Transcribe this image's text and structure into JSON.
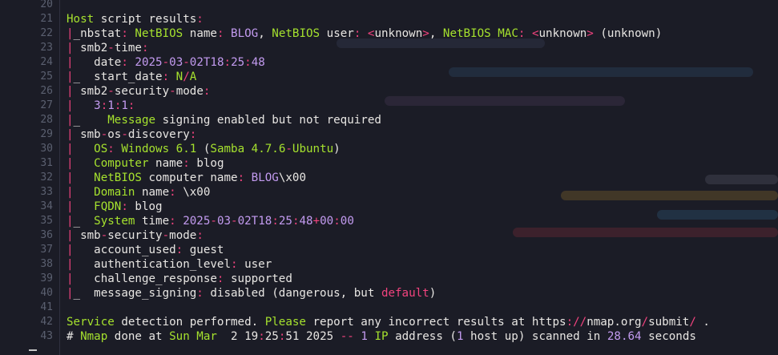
{
  "colors": {
    "background": "#1b1c26",
    "line_number": "#5b6070",
    "text": "#e8e6e3",
    "green": "#a6e22e",
    "purple": "#c39bf0",
    "pink": "#f2437e"
  },
  "lines": [
    {
      "n": "20",
      "segs": []
    },
    {
      "n": "21",
      "segs": [
        {
          "t": "Host",
          "c": "g"
        },
        {
          "t": " script results",
          "c": "w"
        },
        {
          "t": ":",
          "c": "r"
        }
      ]
    },
    {
      "n": "22",
      "segs": [
        {
          "t": "|",
          "c": "r"
        },
        {
          "t": "_nbstat",
          "c": "w"
        },
        {
          "t": ":",
          "c": "r"
        },
        {
          "t": " NetBIOS",
          "c": "g"
        },
        {
          "t": " name",
          "c": "w"
        },
        {
          "t": ":",
          "c": "r"
        },
        {
          "t": " BLOG",
          "c": "p"
        },
        {
          "t": ",",
          "c": "w"
        },
        {
          "t": " NetBIOS",
          "c": "g"
        },
        {
          "t": " user",
          "c": "w"
        },
        {
          "t": ":",
          "c": "r"
        },
        {
          "t": " <",
          "c": "r"
        },
        {
          "t": "unknown",
          "c": "w"
        },
        {
          "t": ">",
          "c": "r"
        },
        {
          "t": ",",
          "c": "w"
        },
        {
          "t": " NetBIOS MAC",
          "c": "g"
        },
        {
          "t": ":",
          "c": "r"
        },
        {
          "t": " <",
          "c": "r"
        },
        {
          "t": "unknown",
          "c": "w"
        },
        {
          "t": ">",
          "c": "r"
        },
        {
          "t": " (unknown)",
          "c": "w"
        }
      ]
    },
    {
      "n": "23",
      "segs": [
        {
          "t": "|",
          "c": "r"
        },
        {
          "t": " smb2",
          "c": "w"
        },
        {
          "t": "-",
          "c": "r"
        },
        {
          "t": "time",
          "c": "w"
        },
        {
          "t": ":",
          "c": "r"
        }
      ]
    },
    {
      "n": "24",
      "segs": [
        {
          "t": "|",
          "c": "r"
        },
        {
          "t": "   date",
          "c": "w"
        },
        {
          "t": ":",
          "c": "r"
        },
        {
          "t": " 2025",
          "c": "p"
        },
        {
          "t": "-",
          "c": "r"
        },
        {
          "t": "03",
          "c": "p"
        },
        {
          "t": "-",
          "c": "r"
        },
        {
          "t": "02T18",
          "c": "p"
        },
        {
          "t": ":",
          "c": "r"
        },
        {
          "t": "25",
          "c": "p"
        },
        {
          "t": ":",
          "c": "r"
        },
        {
          "t": "48",
          "c": "p"
        }
      ]
    },
    {
      "n": "25",
      "segs": [
        {
          "t": "|",
          "c": "r"
        },
        {
          "t": "_  start_date",
          "c": "w"
        },
        {
          "t": ":",
          "c": "r"
        },
        {
          "t": " N",
          "c": "g"
        },
        {
          "t": "/",
          "c": "r"
        },
        {
          "t": "A",
          "c": "g"
        }
      ]
    },
    {
      "n": "26",
      "segs": [
        {
          "t": "|",
          "c": "r"
        },
        {
          "t": " smb2",
          "c": "w"
        },
        {
          "t": "-",
          "c": "r"
        },
        {
          "t": "security",
          "c": "w"
        },
        {
          "t": "-",
          "c": "r"
        },
        {
          "t": "mode",
          "c": "w"
        },
        {
          "t": ":",
          "c": "r"
        }
      ]
    },
    {
      "n": "27",
      "segs": [
        {
          "t": "|",
          "c": "r"
        },
        {
          "t": "   ",
          "c": "w"
        },
        {
          "t": "3",
          "c": "p"
        },
        {
          "t": ":",
          "c": "r"
        },
        {
          "t": "1",
          "c": "p"
        },
        {
          "t": ":",
          "c": "r"
        },
        {
          "t": "1",
          "c": "p"
        },
        {
          "t": ":",
          "c": "r"
        }
      ]
    },
    {
      "n": "28",
      "segs": [
        {
          "t": "|",
          "c": "r"
        },
        {
          "t": "_    ",
          "c": "w"
        },
        {
          "t": "Message",
          "c": "g"
        },
        {
          "t": " signing enabled but not required",
          "c": "w"
        }
      ]
    },
    {
      "n": "29",
      "segs": [
        {
          "t": "|",
          "c": "r"
        },
        {
          "t": " smb",
          "c": "w"
        },
        {
          "t": "-",
          "c": "r"
        },
        {
          "t": "os",
          "c": "w"
        },
        {
          "t": "-",
          "c": "r"
        },
        {
          "t": "discovery",
          "c": "w"
        },
        {
          "t": ":",
          "c": "r"
        }
      ]
    },
    {
      "n": "30",
      "segs": [
        {
          "t": "|",
          "c": "r"
        },
        {
          "t": "   ",
          "c": "w"
        },
        {
          "t": "OS",
          "c": "g"
        },
        {
          "t": ":",
          "c": "r"
        },
        {
          "t": " Windows 6.1",
          "c": "g"
        },
        {
          "t": " (",
          "c": "w"
        },
        {
          "t": "Samba 4.7.6",
          "c": "g"
        },
        {
          "t": "-",
          "c": "r"
        },
        {
          "t": "Ubuntu",
          "c": "g"
        },
        {
          "t": ")",
          "c": "w"
        }
      ]
    },
    {
      "n": "31",
      "segs": [
        {
          "t": "|",
          "c": "r"
        },
        {
          "t": "   ",
          "c": "w"
        },
        {
          "t": "Computer",
          "c": "g"
        },
        {
          "t": " name",
          "c": "w"
        },
        {
          "t": ":",
          "c": "r"
        },
        {
          "t": " blog",
          "c": "w"
        }
      ]
    },
    {
      "n": "32",
      "segs": [
        {
          "t": "|",
          "c": "r"
        },
        {
          "t": "   ",
          "c": "w"
        },
        {
          "t": "NetBIOS",
          "c": "g"
        },
        {
          "t": " computer name",
          "c": "w"
        },
        {
          "t": ":",
          "c": "r"
        },
        {
          "t": " BLOG",
          "c": "p"
        },
        {
          "t": "\\x00",
          "c": "w"
        }
      ]
    },
    {
      "n": "33",
      "segs": [
        {
          "t": "|",
          "c": "r"
        },
        {
          "t": "   ",
          "c": "w"
        },
        {
          "t": "Domain",
          "c": "g"
        },
        {
          "t": " name",
          "c": "w"
        },
        {
          "t": ":",
          "c": "r"
        },
        {
          "t": " \\x00",
          "c": "w"
        }
      ]
    },
    {
      "n": "34",
      "segs": [
        {
          "t": "|",
          "c": "r"
        },
        {
          "t": "   ",
          "c": "w"
        },
        {
          "t": "FQDN",
          "c": "g"
        },
        {
          "t": ":",
          "c": "r"
        },
        {
          "t": " blog",
          "c": "w"
        }
      ]
    },
    {
      "n": "35",
      "segs": [
        {
          "t": "|",
          "c": "r"
        },
        {
          "t": "_  ",
          "c": "w"
        },
        {
          "t": "System",
          "c": "g"
        },
        {
          "t": " time",
          "c": "w"
        },
        {
          "t": ":",
          "c": "r"
        },
        {
          "t": " 2025",
          "c": "p"
        },
        {
          "t": "-",
          "c": "r"
        },
        {
          "t": "03",
          "c": "p"
        },
        {
          "t": "-",
          "c": "r"
        },
        {
          "t": "02T18",
          "c": "p"
        },
        {
          "t": ":",
          "c": "r"
        },
        {
          "t": "25",
          "c": "p"
        },
        {
          "t": ":",
          "c": "r"
        },
        {
          "t": "48",
          "c": "p"
        },
        {
          "t": "+",
          "c": "r"
        },
        {
          "t": "00",
          "c": "p"
        },
        {
          "t": ":",
          "c": "r"
        },
        {
          "t": "00",
          "c": "p"
        }
      ]
    },
    {
      "n": "36",
      "segs": [
        {
          "t": "|",
          "c": "r"
        },
        {
          "t": " smb",
          "c": "w"
        },
        {
          "t": "-",
          "c": "r"
        },
        {
          "t": "security",
          "c": "w"
        },
        {
          "t": "-",
          "c": "r"
        },
        {
          "t": "mode",
          "c": "w"
        },
        {
          "t": ":",
          "c": "r"
        }
      ]
    },
    {
      "n": "37",
      "segs": [
        {
          "t": "|",
          "c": "r"
        },
        {
          "t": "   account_used",
          "c": "w"
        },
        {
          "t": ":",
          "c": "r"
        },
        {
          "t": " guest",
          "c": "w"
        }
      ]
    },
    {
      "n": "38",
      "segs": [
        {
          "t": "|",
          "c": "r"
        },
        {
          "t": "   authentication_level",
          "c": "w"
        },
        {
          "t": ":",
          "c": "r"
        },
        {
          "t": " user",
          "c": "w"
        }
      ]
    },
    {
      "n": "39",
      "segs": [
        {
          "t": "|",
          "c": "r"
        },
        {
          "t": "   challenge_response",
          "c": "w"
        },
        {
          "t": ":",
          "c": "r"
        },
        {
          "t": " supported",
          "c": "w"
        }
      ]
    },
    {
      "n": "40",
      "segs": [
        {
          "t": "|",
          "c": "r"
        },
        {
          "t": "_  message_signing",
          "c": "w"
        },
        {
          "t": ":",
          "c": "r"
        },
        {
          "t": " disabled (dangerous, but ",
          "c": "w"
        },
        {
          "t": "default",
          "c": "r"
        },
        {
          "t": ")",
          "c": "w"
        }
      ]
    },
    {
      "n": "41",
      "segs": []
    },
    {
      "n": "42",
      "segs": [
        {
          "t": "Service",
          "c": "g"
        },
        {
          "t": " detection performed. ",
          "c": "w"
        },
        {
          "t": "Please",
          "c": "g"
        },
        {
          "t": " report any incorrect results at https",
          "c": "w"
        },
        {
          "t": "://",
          "c": "r"
        },
        {
          "t": "nmap.org",
          "c": "w"
        },
        {
          "t": "/",
          "c": "r"
        },
        {
          "t": "submit",
          "c": "w"
        },
        {
          "t": "/",
          "c": "r"
        },
        {
          "t": " .",
          "c": "w"
        }
      ]
    },
    {
      "n": "43",
      "segs": [
        {
          "t": "# ",
          "c": "w"
        },
        {
          "t": "Nmap",
          "c": "g"
        },
        {
          "t": " done at ",
          "c": "w"
        },
        {
          "t": "Sun Mar",
          "c": "g"
        },
        {
          "t": "  2 19",
          "c": "w"
        },
        {
          "t": ":",
          "c": "r"
        },
        {
          "t": "25",
          "c": "w"
        },
        {
          "t": ":",
          "c": "r"
        },
        {
          "t": "51 2025 ",
          "c": "w"
        },
        {
          "t": "--",
          "c": "r"
        },
        {
          "t": " 1",
          "c": "p"
        },
        {
          "t": " IP",
          "c": "g"
        },
        {
          "t": " address (",
          "c": "w"
        },
        {
          "t": "1",
          "c": "p"
        },
        {
          "t": " host up) scanned in ",
          "c": "w"
        },
        {
          "t": "28.64",
          "c": "p"
        },
        {
          "t": " seconds",
          "c": "w"
        }
      ]
    }
  ]
}
